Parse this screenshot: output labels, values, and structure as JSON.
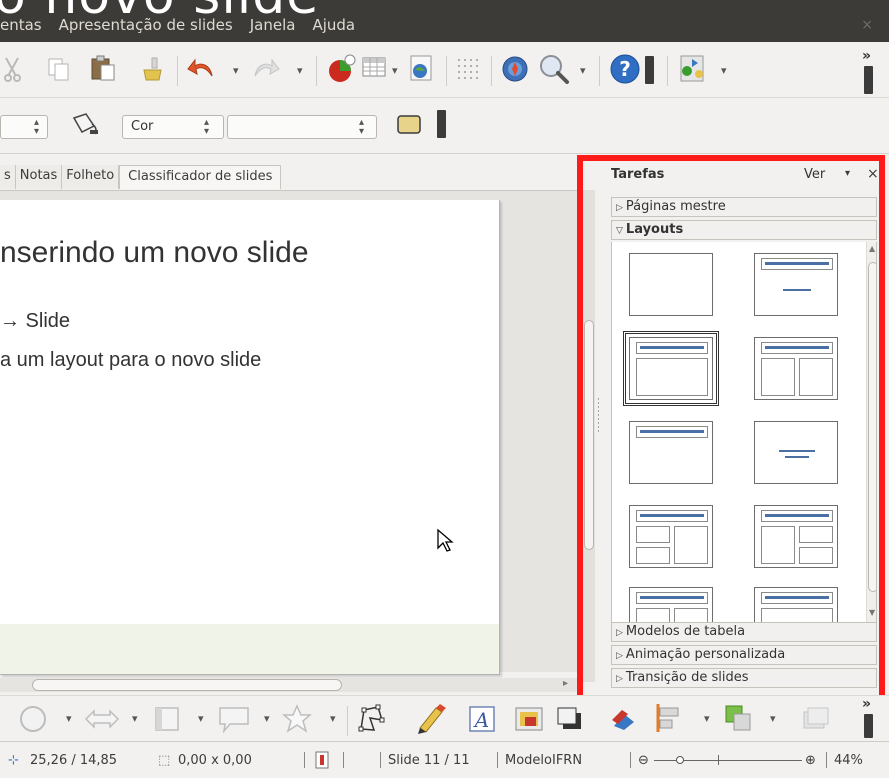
{
  "window": {
    "ghost_title": "o novo slide"
  },
  "menu": {
    "items": [
      "entas",
      "Apresentação de slides",
      "Janela",
      "Ajuda"
    ],
    "close": "×"
  },
  "toolbar2": {
    "color_label": "Cor"
  },
  "tabs": [
    "s",
    "Notas",
    "Folheto",
    "Classificador de slides"
  ],
  "slide": {
    "title": "nserindo um novo slide",
    "bullet1": "→ Slide",
    "bullet2": "a um layout para o novo slide"
  },
  "task_pane": {
    "title": "Tarefas",
    "view_label": "Ver",
    "close": "×",
    "sections": {
      "master_pages": "Páginas mestre",
      "layouts": "Layouts",
      "table_models": "Modelos de tabela",
      "custom_animation": "Animação personalizada",
      "slide_transition": "Transição de slides"
    }
  },
  "status": {
    "position": "25,26 / 14,85",
    "size": "0,00 x 0,00",
    "slide_counter": "Slide 11 / 11",
    "master": "ModeloIFRN",
    "zoom": "44%"
  },
  "colors": {
    "menubar": "#3c3b37",
    "highlight": "#ff1a1a",
    "layout_bar": "#4a6fa5",
    "slide_footer": "#f0f3e7"
  }
}
